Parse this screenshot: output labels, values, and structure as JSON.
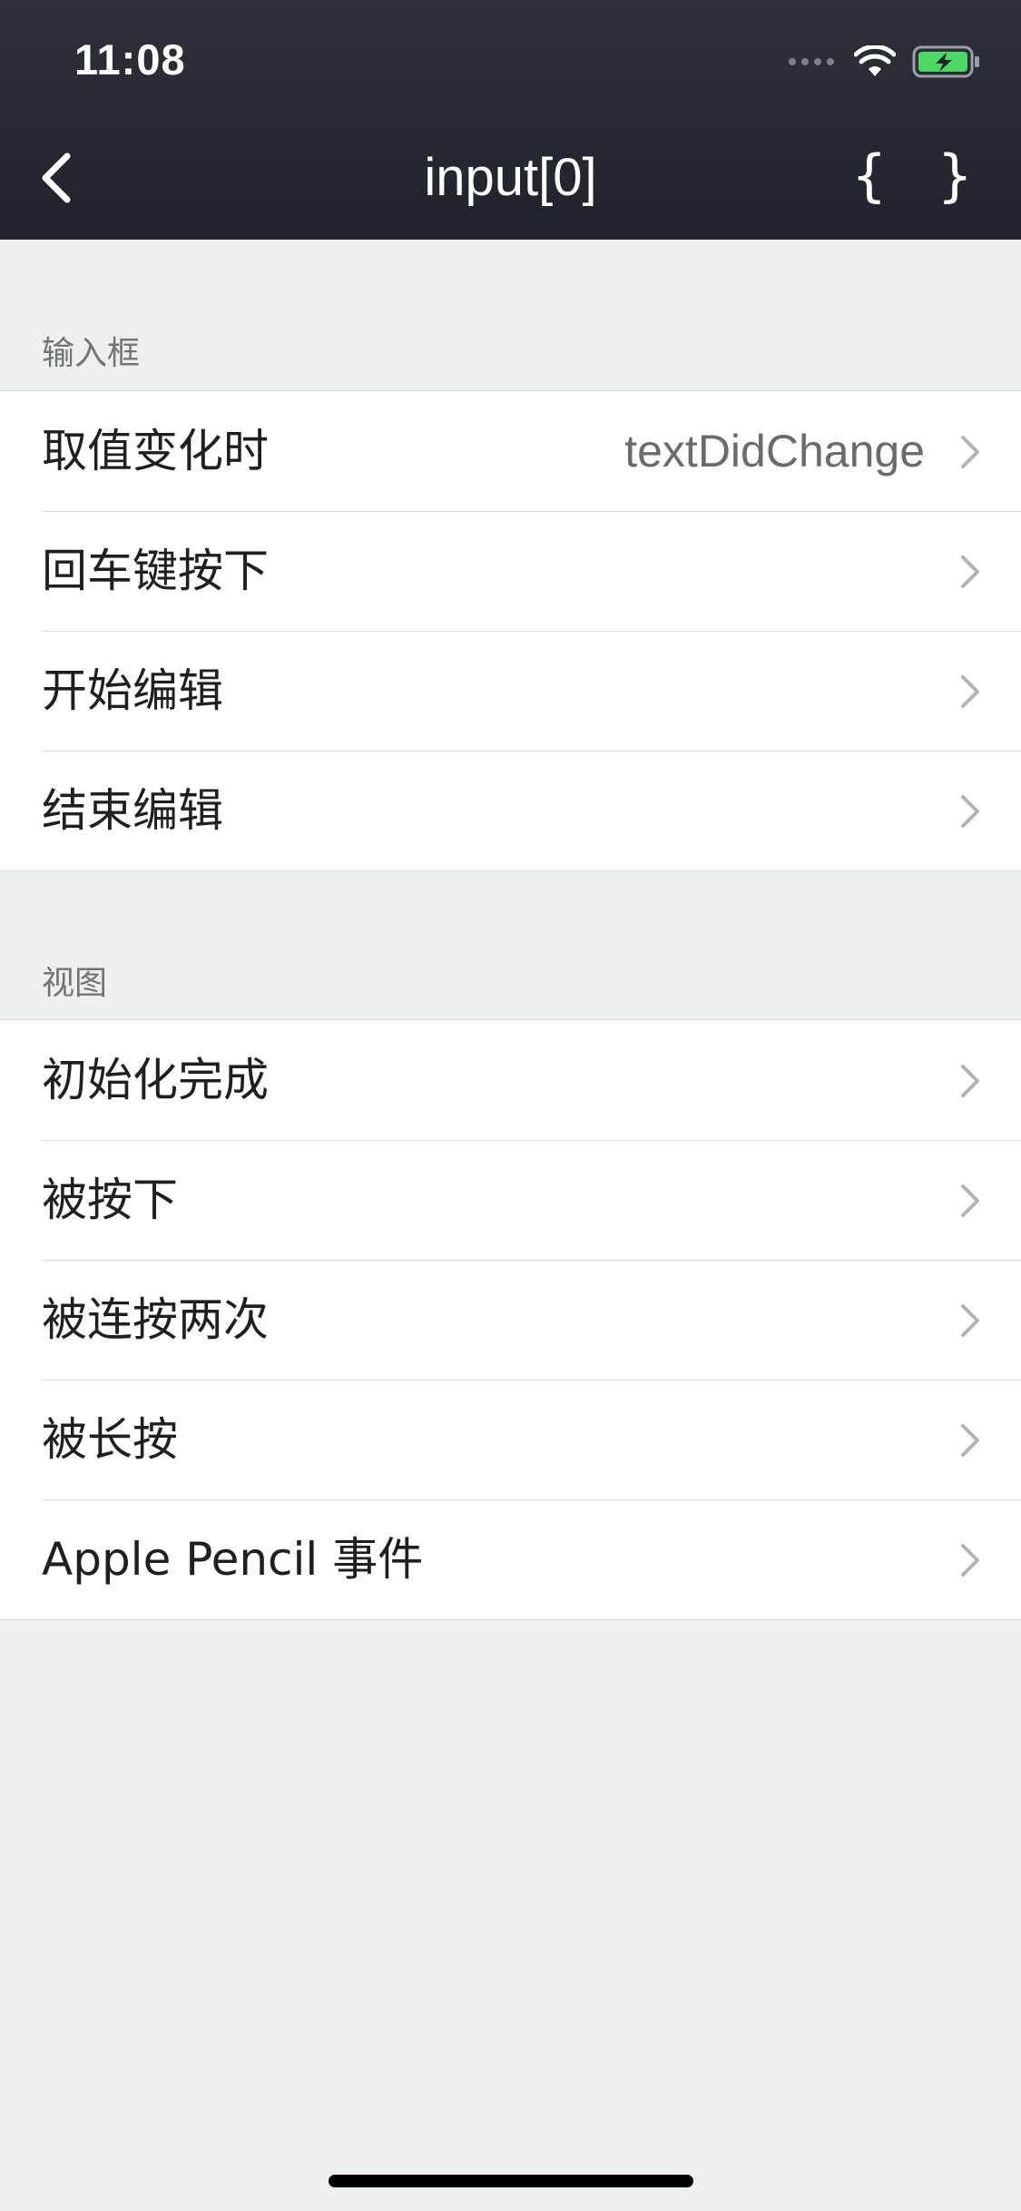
{
  "status_bar": {
    "time": "11:08",
    "battery_color": "#4cd964"
  },
  "nav": {
    "title": "input[0]",
    "json_button_label": "{ }"
  },
  "sections": [
    {
      "header": "输入框",
      "rows": [
        {
          "label": "取值变化时",
          "value": "textDidChange"
        },
        {
          "label": "回车键按下",
          "value": ""
        },
        {
          "label": "开始编辑",
          "value": ""
        },
        {
          "label": "结束编辑",
          "value": ""
        }
      ]
    },
    {
      "header": "视图",
      "rows": [
        {
          "label": "初始化完成",
          "value": ""
        },
        {
          "label": "被按下",
          "value": ""
        },
        {
          "label": "被连按两次",
          "value": ""
        },
        {
          "label": "被长按",
          "value": ""
        },
        {
          "label": "Apple Pencil 事件",
          "value": ""
        }
      ]
    }
  ]
}
